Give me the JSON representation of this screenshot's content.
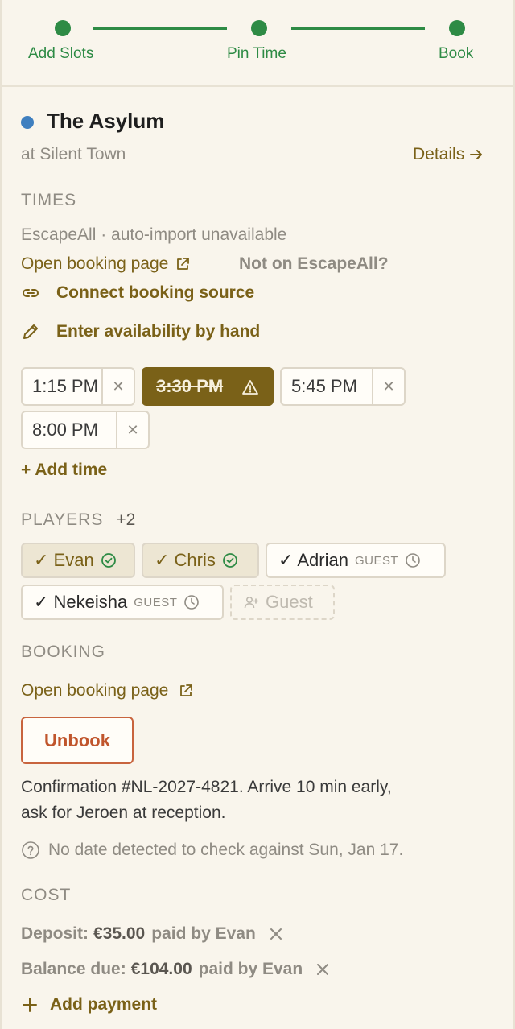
{
  "stepper": {
    "steps": [
      {
        "label": "Add Slots"
      },
      {
        "label": "Pin Time"
      },
      {
        "label": "Book"
      }
    ],
    "color": "#2e8b45"
  },
  "room": {
    "dot_color": "#3f7fbf",
    "title": "The Asylum",
    "venue": "at Silent Town",
    "details_label": "Details"
  },
  "times": {
    "section_label": "TIMES",
    "source_note": "EscapeAll · auto-import unavailable",
    "open_booking_label": "Open booking page",
    "not_on_label": "Not on EscapeAll?",
    "connect_label": "Connect booking source",
    "enter_label": "Enter availability by hand",
    "slots": [
      {
        "time": "1:15 PM",
        "state": "normal"
      },
      {
        "time": "3:30 PM",
        "state": "conflict"
      },
      {
        "time": "5:45 PM",
        "state": "normal"
      },
      {
        "time": "8:00 PM",
        "state": "normal"
      }
    ],
    "add_time_label": "+ Add time"
  },
  "players": {
    "section_label": "PLAYERS",
    "extra_count": "+2",
    "list": [
      {
        "name": "✓ Evan",
        "tag": "",
        "status": "confirmed"
      },
      {
        "name": "✓ Chris",
        "tag": "",
        "status": "confirmed"
      },
      {
        "name": "✓ Adrian",
        "tag": "GUEST",
        "status": "pending"
      },
      {
        "name": "✓ Nekeisha",
        "tag": "GUEST",
        "status": "pending"
      }
    ],
    "add_guest_label": "Guest"
  },
  "booking": {
    "section_label": "BOOKING",
    "open_booking_label": "Open booking page",
    "unbook_label": "Unbook",
    "confirmation_line1": "Confirmation #NL-2027-4821. Arrive 10 min early,",
    "confirmation_line2": "ask for Jeroen at reception.",
    "date_note": "No date detected to check against Sun, Jan 17."
  },
  "cost": {
    "section_label": "COST",
    "payments": [
      {
        "label": "Deposit:",
        "amount": "€35.00",
        "payer": "paid by Evan"
      },
      {
        "label": "Balance due:",
        "amount": "€104.00",
        "payer": "paid by Evan"
      }
    ],
    "add_payment_label": "Add payment"
  }
}
